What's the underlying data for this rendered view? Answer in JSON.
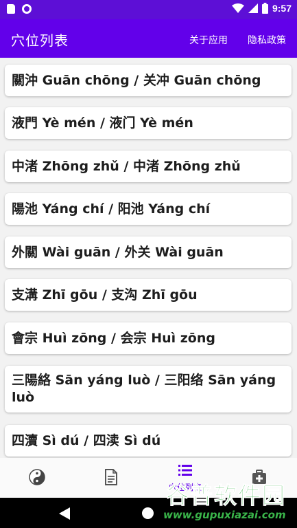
{
  "status_bar": {
    "time": "9:57",
    "icons": [
      "sd-card-icon",
      "circle-notification-icon",
      "wifi-icon",
      "signal-icon",
      "battery-icon"
    ]
  },
  "app_bar": {
    "title": "穴位列表",
    "actions": {
      "about": "关于应用",
      "privacy": "隐私政策"
    }
  },
  "list": {
    "items": [
      {
        "label": "關沖 Guān chōng / 关冲 Guān chōng"
      },
      {
        "label": "液門 Yè mén / 液门 Yè mén"
      },
      {
        "label": "中渚 Zhōng zhǔ / 中渚 Zhōng zhǔ"
      },
      {
        "label": "陽池 Yáng chí / 阳池 Yáng chí"
      },
      {
        "label": "外關 Wài guān / 外关 Wài guān"
      },
      {
        "label": "支溝 Zhī gōu / 支沟 Zhī gōu"
      },
      {
        "label": "會宗 Huì zōng / 会宗 Huì zōng"
      },
      {
        "label": "三陽絡 Sān yáng luò / 三阳络 Sān yáng luò"
      },
      {
        "label": "四瀆 Sì dú / 四渎 Sì dú"
      }
    ]
  },
  "bottom_nav": {
    "items": [
      {
        "icon": "yin-yang-icon",
        "label": ""
      },
      {
        "icon": "document-icon",
        "label": ""
      },
      {
        "icon": "list-icon",
        "label": "穴位列表",
        "active": true
      },
      {
        "icon": "medical-kit-icon",
        "label": ""
      }
    ]
  },
  "colors": {
    "status_bar": "#5d0fd6",
    "app_bar": "#6200ea",
    "accent": "#6200ea",
    "background": "#f2f2f2"
  },
  "watermark": {
    "main": "谷普软件园",
    "sub": "www.gupuxiazai.com"
  }
}
